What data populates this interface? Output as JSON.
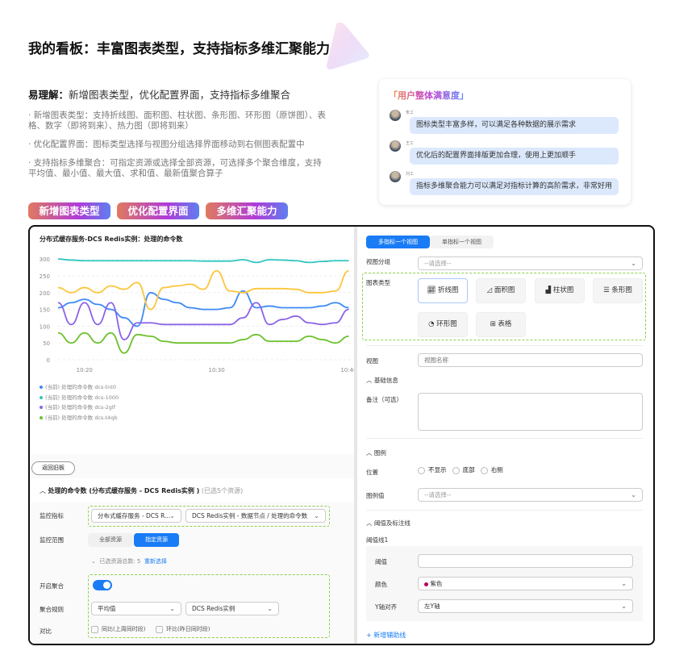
{
  "page": {
    "title": "我的看板：丰富图表类型，支持指标多维汇聚能力",
    "subtitle_bold": "易理解：",
    "subtitle": "新增图表类型，优化配置界面，支持指标多维聚合",
    "bullets": [
      "· 新增图表类型：支持折线图、面积图、柱状图、条形图、环形图（原饼图）、表格、数字（即将到来）、热力图（即将到来）",
      "· 优化配置界面：图标类型选择与视图分组选择界面移动到右侧图表配置中",
      "· 支持指标多维聚合：可指定资源或选择全部资源，可选择多个聚合维度，支持平均值、最小值、最大值、求和值、最新值聚合算子"
    ],
    "tags": [
      "新增图表类型",
      "优化配置界面",
      "多维汇聚能力"
    ]
  },
  "feedback": {
    "title": "「用户整体满意度」",
    "items": [
      {
        "name": "朱工",
        "text": "图标类型丰富多样，可以满足各种数据的展示需求"
      },
      {
        "name": "王工",
        "text": "优化后的配置界面排版更加合理，使用上更加顺手"
      },
      {
        "name": "刘工",
        "text": "指标多维聚合能力可以满足对指标计算的高阶需求，非常好用"
      }
    ]
  },
  "chart_data": {
    "type": "line",
    "title": "分布式缓存服务-DCS Redis实例：处理的命令数",
    "x": [
      "10:18",
      "10:19",
      "10:20",
      "10:21",
      "10:22",
      "10:23",
      "10:24",
      "10:25",
      "10:26",
      "10:27",
      "10:28",
      "10:29",
      "10:30",
      "10:31",
      "10:32",
      "10:33",
      "10:34",
      "10:35",
      "10:36",
      "10:37",
      "10:38",
      "10:39",
      "10:40"
    ],
    "xticks": [
      "10:20",
      "10:30",
      "10:40"
    ],
    "yticks": [
      0,
      50,
      100,
      150,
      200,
      250,
      300
    ],
    "ylim": [
      0,
      320
    ],
    "grid": true,
    "legend_position": "bottom-left",
    "series": [
      {
        "name": "(当前) 处理的命令数 dcs-tnt0",
        "color": "#3d8af7",
        "values": [
          155,
          170,
          180,
          165,
          150,
          125,
          100,
          200,
          180,
          170,
          155,
          150,
          150,
          155,
          205,
          155,
          160,
          155,
          155,
          155,
          160,
          170,
          155
        ]
      },
      {
        "name": "(当前) 处理的命令数 dcs-1000",
        "color": "#2ec7c0",
        "values": [
          300,
          297,
          295,
          295,
          295,
          295,
          295,
          295,
          295,
          295,
          295,
          294,
          294,
          294,
          298,
          290,
          298,
          297,
          295,
          290,
          293,
          295,
          295
        ]
      },
      {
        "name": "(当前) 处理的命令数 dcs-2glf",
        "color": "#8a63e8",
        "values": [
          170,
          105,
          170,
          105,
          170,
          60,
          110,
          110,
          105,
          105,
          105,
          105,
          105,
          105,
          125,
          170,
          105,
          120,
          130,
          110,
          105,
          110,
          150
        ]
      },
      {
        "name": "(当前) 处理的命令数 dcs-t4qb",
        "color": "#6cc12b",
        "values": [
          80,
          50,
          80,
          50,
          80,
          20,
          75,
          70,
          55,
          50,
          50,
          50,
          50,
          50,
          60,
          75,
          55,
          55,
          55,
          70,
          60,
          50,
          70
        ]
      },
      {
        "name": "",
        "color": "#fcc53a",
        "values": [
          215,
          200,
          215,
          200,
          220,
          210,
          230,
          150,
          215,
          220,
          225,
          210,
          265,
          205,
          200,
          212,
          212,
          212,
          210,
          200,
          200,
          205,
          265
        ]
      }
    ]
  },
  "left": {
    "back_button": "返回旧板",
    "section_title": "处理的命令数 (分布式缓存服务 - DCS Redis实例 )",
    "section_count": "(已选5个资源)",
    "metric_label": "监控指标",
    "metric_sel1": "分布式缓存服务 - DCS R...",
    "metric_sel2": "DCS Redis实例 - 数据节点 / 处理的命令数",
    "scope_label": "监控范围",
    "scope_all": "全部资源",
    "scope_specified": "指定资源",
    "selected_count": "已选资源总数: 5",
    "reselect": "重新选择",
    "agg_label": "开启聚合",
    "agg_enabled": true,
    "rule_label": "聚合规则",
    "rule_sel1": "平均值",
    "rule_sel2": "DCS Redis实例",
    "compare_label": "对比",
    "compare_opt1": "同比(上周同时段)",
    "compare_opt2": "环比(昨日同时段)"
  },
  "right": {
    "tab_multi": "多指标一个视图",
    "tab_single": "单指标一个视图",
    "group_label": "视图分组",
    "group_placeholder": "--请选择--",
    "chart_type_label": "图表类型",
    "chart_types": [
      "折线图",
      "面积图",
      "柱状图",
      "条形图",
      "环形图",
      "表格"
    ],
    "view_label": "视图",
    "view_placeholder": "视图名称",
    "basic_info": "基础信息",
    "remark_label": "备注（可选）",
    "legend_section": "图例",
    "position_label": "位置",
    "position_opts": [
      "不显示",
      "底部",
      "右侧"
    ],
    "legend_value_label": "图例值",
    "legend_value_placeholder": "--请选择--",
    "threshold_section": "阈值及标注线",
    "threshold_line": "阈值线1",
    "threshold_label": "阈值",
    "color_label": "颜色",
    "color_value": "紫色",
    "color_hex": "#b5005e",
    "yaxis_label": "Y轴对齐",
    "yaxis_value": "左Y轴",
    "add_line": "新增辅助线"
  }
}
